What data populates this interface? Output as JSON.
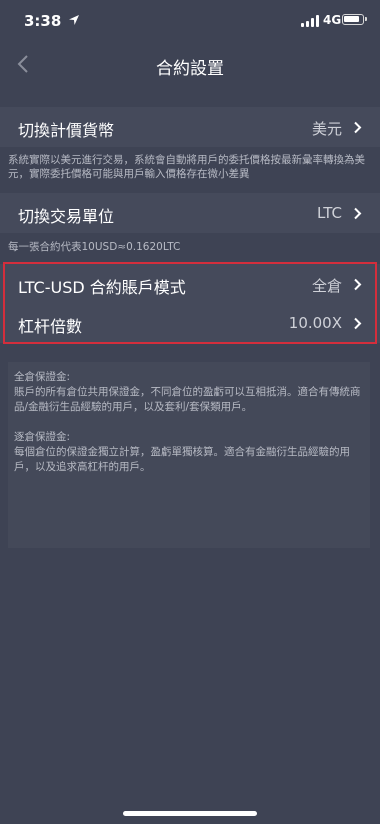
{
  "status": {
    "time": "3:38",
    "network": "4G"
  },
  "nav": {
    "title": "合約設置"
  },
  "rows": [
    {
      "label": "切換計價貨幣",
      "value": "美元"
    },
    {
      "label": "切換交易單位",
      "value": "LTC"
    },
    {
      "label": "LTC-USD 合約賬戶模式",
      "value": "全倉"
    },
    {
      "label": "杠杆倍數",
      "value": "10.00X"
    }
  ],
  "notes": {
    "currency": "系統實際以美元進行交易，系統會自動將用戶的委托價格按最新彙率轉換為美元，實際委托價格可能與用戶輸入價格存在微小差異",
    "unit": "每一張合約代表10USD≈0.1620LTC"
  },
  "info": {
    "cross_title": "全倉保證金:",
    "cross_desc": "賬戶的所有倉位共用保證金，不同倉位的盈虧可以互相抵消。適合有傳統商品/金融衍生品經驗的用戶，以及套利/套保類用戶。",
    "isolated_title": "逐倉保證金:",
    "isolated_desc": "每個倉位的保證金獨立計算，盈虧單獨核算。適合有金融衍生品經驗的用戶，以及追求高杠杆的用戶。"
  },
  "colors": {
    "background": "#3e4354",
    "row": "#454a5b",
    "highlight": "#d42e3c"
  }
}
